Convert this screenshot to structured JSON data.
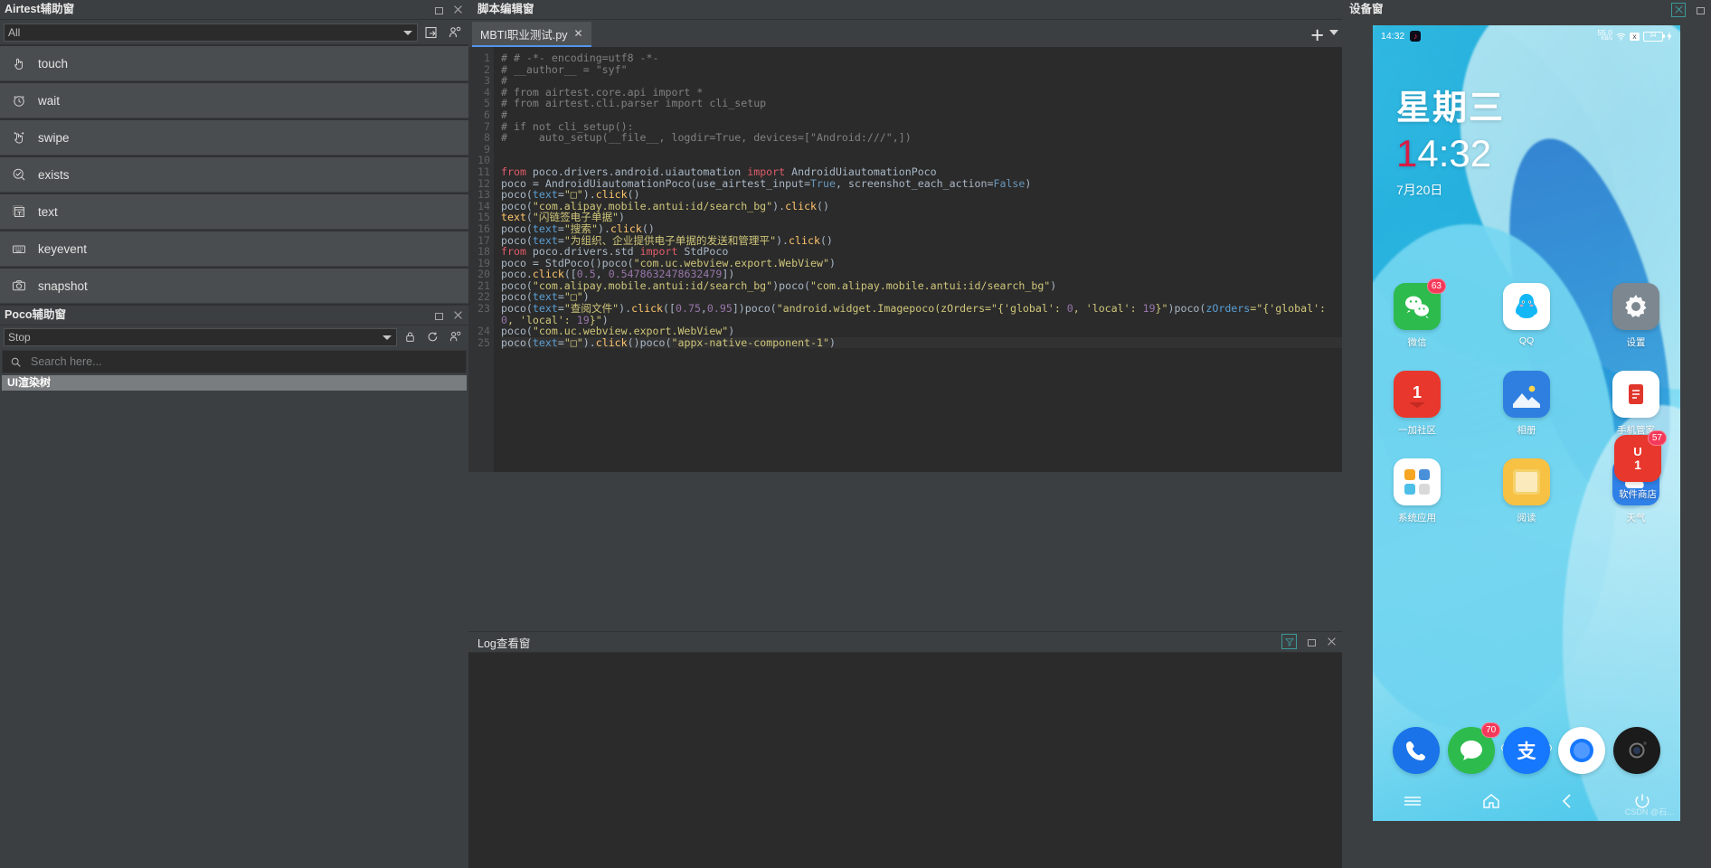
{
  "airtest_panel": {
    "title": "Airtest辅助窗",
    "filter_value": "All",
    "toolbar": [
      {
        "name": "open-script-button",
        "icon": "open-folder-icon"
      },
      {
        "name": "record-script-button",
        "icon": "record-icon"
      }
    ],
    "actions": [
      {
        "label": "touch",
        "icon": "touch-hand-icon"
      },
      {
        "label": "wait",
        "icon": "clock-icon"
      },
      {
        "label": "swipe",
        "icon": "swipe-hand-icon"
      },
      {
        "label": "exists",
        "icon": "check-circle-icon"
      },
      {
        "label": "text",
        "icon": "text-box-icon"
      },
      {
        "label": "keyevent",
        "icon": "keyboard-icon"
      },
      {
        "label": "snapshot",
        "icon": "camera-icon"
      }
    ]
  },
  "poco_panel": {
    "title": "Poco辅助窗",
    "mode_value": "Stop",
    "toolbar": [
      {
        "name": "lock-button",
        "icon": "lock-icon"
      },
      {
        "name": "refresh-button",
        "icon": "refresh-icon"
      },
      {
        "name": "inspect-button",
        "icon": "inspect-icon"
      }
    ],
    "search_placeholder": "Search here...",
    "search_value": "",
    "tree_header": "UI渲染树"
  },
  "editor": {
    "title": "脚本编辑窗",
    "tabs": [
      {
        "label": "MBTI职业测试.py",
        "close": "✕",
        "active": true
      }
    ],
    "add_tab_label": "+",
    "highlight_line": 25,
    "lines": [
      {
        "n": 1,
        "tokens": [
          {
            "t": "# # -*- encoding=utf8 -*-",
            "c": "cm"
          }
        ]
      },
      {
        "n": 2,
        "tokens": [
          {
            "t": "# __author__ = \"syf\"",
            "c": "cm"
          }
        ]
      },
      {
        "n": 3,
        "tokens": [
          {
            "t": "#",
            "c": "cm"
          }
        ]
      },
      {
        "n": 4,
        "tokens": [
          {
            "t": "# from airtest.core.api import *",
            "c": "cm"
          }
        ]
      },
      {
        "n": 5,
        "tokens": [
          {
            "t": "# from airtest.cli.parser import cli_setup",
            "c": "cm"
          }
        ]
      },
      {
        "n": 6,
        "tokens": [
          {
            "t": "#",
            "c": "cm"
          }
        ]
      },
      {
        "n": 7,
        "tokens": [
          {
            "t": "# if not cli_setup():",
            "c": "cm"
          }
        ]
      },
      {
        "n": 8,
        "tokens": [
          {
            "t": "#     auto_setup(__file__, logdir=True, devices=[\"Android:///\",])",
            "c": "cm"
          }
        ]
      },
      {
        "n": 9,
        "tokens": []
      },
      {
        "n": 10,
        "tokens": []
      },
      {
        "n": 11,
        "tokens": [
          {
            "t": "from",
            "c": "kw2"
          },
          {
            "t": " poco.drivers.android.uiautomation ",
            "c": "pl"
          },
          {
            "t": "import",
            "c": "kw2"
          },
          {
            "t": " AndroidUiautomationPoco",
            "c": "pl"
          }
        ]
      },
      {
        "n": 12,
        "tokens": [
          {
            "t": "poco = AndroidUiautomationPoco(",
            "c": "pl"
          },
          {
            "t": "use_airtest_input",
            "c": "pl"
          },
          {
            "t": "=",
            "c": "pl"
          },
          {
            "t": "True",
            "c": "vs"
          },
          {
            "t": ", ",
            "c": "pl"
          },
          {
            "t": "screenshot_each_action",
            "c": "pl"
          },
          {
            "t": "=",
            "c": "pl"
          },
          {
            "t": "False",
            "c": "vs"
          },
          {
            "t": ")",
            "c": "pl"
          }
        ]
      },
      {
        "n": 13,
        "tokens": [
          {
            "t": "poco(",
            "c": "pl"
          },
          {
            "t": "text",
            "c": "arg"
          },
          {
            "t": "=",
            "c": "pl"
          },
          {
            "t": "\"",
            "c": "str"
          },
          {
            "t": "□",
            "c": "str"
          },
          {
            "t": "\"",
            "c": "str"
          },
          {
            "t": ").",
            "c": "pl"
          },
          {
            "t": "click",
            "c": "fn"
          },
          {
            "t": "()",
            "c": "pl"
          }
        ]
      },
      {
        "n": 14,
        "tokens": [
          {
            "t": "poco(",
            "c": "pl"
          },
          {
            "t": "\"com.alipay.mobile.antui:id/search_bg\"",
            "c": "str"
          },
          {
            "t": ").",
            "c": "pl"
          },
          {
            "t": "click",
            "c": "fn"
          },
          {
            "t": "()",
            "c": "pl"
          }
        ]
      },
      {
        "n": 15,
        "tokens": [
          {
            "t": "text",
            "c": "fn"
          },
          {
            "t": "(",
            "c": "pl"
          },
          {
            "t": "\"闪链签电子单据\"",
            "c": "str"
          },
          {
            "t": ")",
            "c": "pl"
          }
        ]
      },
      {
        "n": 16,
        "tokens": [
          {
            "t": "poco(",
            "c": "pl"
          },
          {
            "t": "text",
            "c": "arg"
          },
          {
            "t": "=",
            "c": "pl"
          },
          {
            "t": "\"搜索\"",
            "c": "str"
          },
          {
            "t": ").",
            "c": "pl"
          },
          {
            "t": "click",
            "c": "fn"
          },
          {
            "t": "()",
            "c": "pl"
          }
        ]
      },
      {
        "n": 17,
        "tokens": [
          {
            "t": "poco(",
            "c": "pl"
          },
          {
            "t": "text",
            "c": "arg"
          },
          {
            "t": "=",
            "c": "pl"
          },
          {
            "t": "\"为组织、企业提供电子单据的发送和管理平\"",
            "c": "str"
          },
          {
            "t": ").",
            "c": "pl"
          },
          {
            "t": "click",
            "c": "fn"
          },
          {
            "t": "()",
            "c": "pl"
          }
        ]
      },
      {
        "n": 18,
        "tokens": [
          {
            "t": "from",
            "c": "kw2"
          },
          {
            "t": " poco.drivers.std ",
            "c": "pl"
          },
          {
            "t": "import",
            "c": "kw2"
          },
          {
            "t": " StdPoco",
            "c": "pl"
          }
        ]
      },
      {
        "n": 19,
        "tokens": [
          {
            "t": "poco = StdPoco()poco(",
            "c": "pl"
          },
          {
            "t": "\"com.uc.webview.export.WebView\"",
            "c": "str"
          },
          {
            "t": ")",
            "c": "pl"
          }
        ]
      },
      {
        "n": 20,
        "tokens": [
          {
            "t": "poco.",
            "c": "pl"
          },
          {
            "t": "click",
            "c": "fn"
          },
          {
            "t": "([",
            "c": "pl"
          },
          {
            "t": "0.5",
            "c": "num"
          },
          {
            "t": ", ",
            "c": "pl"
          },
          {
            "t": "0.5478632478632479",
            "c": "num"
          },
          {
            "t": "])",
            "c": "pl"
          }
        ]
      },
      {
        "n": 21,
        "tokens": [
          {
            "t": "poco(",
            "c": "pl"
          },
          {
            "t": "\"com.alipay.mobile.antui:id/search_bg\"",
            "c": "str"
          },
          {
            "t": ")poco(",
            "c": "pl"
          },
          {
            "t": "\"com.alipay.mobile.antui:id/search_bg\"",
            "c": "str"
          },
          {
            "t": ")",
            "c": "pl"
          }
        ]
      },
      {
        "n": 22,
        "tokens": [
          {
            "t": "poco(",
            "c": "pl"
          },
          {
            "t": "text",
            "c": "arg"
          },
          {
            "t": "=",
            "c": "pl"
          },
          {
            "t": "\"□\"",
            "c": "str"
          },
          {
            "t": ")",
            "c": "pl"
          }
        ]
      },
      {
        "n": 23,
        "wrap": true,
        "tokens": [
          {
            "t": "poco(",
            "c": "pl"
          },
          {
            "t": "text",
            "c": "arg"
          },
          {
            "t": "=",
            "c": "pl"
          },
          {
            "t": "\"查阅文件\"",
            "c": "str"
          },
          {
            "t": ").",
            "c": "pl"
          },
          {
            "t": "click",
            "c": "fn"
          },
          {
            "t": "([",
            "c": "pl"
          },
          {
            "t": "0.75",
            "c": "num"
          },
          {
            "t": ",",
            "c": "pl"
          },
          {
            "t": "0.95",
            "c": "num"
          },
          {
            "t": "])poco(",
            "c": "pl"
          },
          {
            "t": "\"android.widget.Imagepoco(zOrders=\"",
            "c": "str"
          },
          {
            "t": "{'global': ",
            "c": "str"
          },
          {
            "t": "0",
            "c": "num"
          },
          {
            "t": ", 'local': ",
            "c": "str"
          },
          {
            "t": "19",
            "c": "num"
          },
          {
            "t": "}\"",
            "c": "str"
          },
          {
            "t": ")poco(",
            "c": "pl"
          },
          {
            "t": "zOrders",
            "c": "arg"
          },
          {
            "t": "=\"",
            "c": "str"
          },
          {
            "t": "{'global': ",
            "c": "str"
          },
          {
            "t": "0",
            "c": "num"
          },
          {
            "t": ", 'local': ",
            "c": "str"
          },
          {
            "t": "19",
            "c": "num"
          },
          {
            "t": "}\"",
            "c": "str"
          },
          {
            "t": ")",
            "c": "pl"
          }
        ]
      },
      {
        "n": 24,
        "tokens": [
          {
            "t": "poco(",
            "c": "pl"
          },
          {
            "t": "\"com.uc.webview.export.WebView\"",
            "c": "str"
          },
          {
            "t": ")",
            "c": "pl"
          }
        ]
      },
      {
        "n": 25,
        "tokens": [
          {
            "t": "poco(",
            "c": "pl"
          },
          {
            "t": "text",
            "c": "arg"
          },
          {
            "t": "=",
            "c": "pl"
          },
          {
            "t": "\"□\"",
            "c": "str"
          },
          {
            "t": ").",
            "c": "pl"
          },
          {
            "t": "click",
            "c": "fn"
          },
          {
            "t": "()poco(",
            "c": "pl"
          },
          {
            "t": "\"appx-native-component-1\"",
            "c": "str"
          },
          {
            "t": ")",
            "c": "pl"
          }
        ]
      }
    ]
  },
  "log_panel": {
    "title": "Log查看窗",
    "buttons": [
      {
        "name": "filter-button",
        "icon": "filter-icon"
      },
      {
        "name": "restore-button",
        "icon": "restore-icon"
      },
      {
        "name": "close-button",
        "icon": "close-icon"
      }
    ]
  },
  "device_panel": {
    "title": "设备窗",
    "buttons": [
      {
        "name": "yoga-layout-button",
        "icon": "yoga-icon"
      },
      {
        "name": "restore-button",
        "icon": "restore-icon"
      }
    ],
    "screen": {
      "statusbar": {
        "time": "14:32",
        "app_icon": "tiktok-icon",
        "net_speed": "55.0",
        "net_unit": "KB/s",
        "wifi": "wifi-icon",
        "signal": "signal-icon",
        "battery_text": "94",
        "charging": "charging-bolt-icon"
      },
      "clock_widget": {
        "weekday": "星期三",
        "hour_first": "1",
        "time_rest": "4:32",
        "date": "7月20日"
      },
      "apps": [
        [
          {
            "label": "微信",
            "badge": "63",
            "color": "#2dbb4e",
            "glyph": "wechat-icon"
          },
          {
            "label": "QQ",
            "badge": "",
            "color": "#ffffff",
            "glyph": "qq-icon"
          },
          {
            "label": "设置",
            "badge": "",
            "color": "#7d8790",
            "glyph": "gear-icon"
          }
        ],
        [
          {
            "label": "一加社区",
            "badge": "",
            "color": "#e8372c",
            "glyph": "oneplus-community-icon"
          },
          {
            "label": "相册",
            "badge": "",
            "color": "#2f7fe0",
            "glyph": "gallery-icon"
          },
          {
            "label": "手机管家",
            "badge": "",
            "color": "#ffffff",
            "glyph": "phone-manager-icon"
          }
        ],
        [
          {
            "label": "系统应用",
            "badge": "",
            "color": "#ffffff",
            "glyph": "system-apps-folder-icon"
          },
          {
            "label": "阅读",
            "badge": "",
            "color": "#f7c144",
            "glyph": "reader-icon"
          },
          {
            "label": "天气",
            "badge": "",
            "color": "#2f80e8",
            "glyph": "weather-icon"
          }
        ]
      ],
      "dock": [
        {
          "label": "",
          "badge": "",
          "color": "#1a73e8",
          "glyph": "phone-icon"
        },
        {
          "label": "",
          "badge": "70",
          "color": "#2dbb4e",
          "glyph": "messages-icon"
        },
        {
          "label": "",
          "badge": "",
          "color": "#1677ff",
          "glyph": "alipay-icon"
        },
        {
          "label": "",
          "badge": "",
          "color": "#ffffff",
          "glyph": "browser-icon"
        },
        {
          "label": "",
          "badge": "",
          "color": "#1b1b1b",
          "glyph": "camera-app-icon"
        }
      ],
      "software_store": {
        "label": "软件商店",
        "badge": "57",
        "color": "#e8372c",
        "glyph": "store-icon"
      },
      "page_dots": [
        false,
        true,
        false,
        false
      ],
      "navbar": [
        {
          "name": "nav-menu-button",
          "icon": "menu-icon"
        },
        {
          "name": "nav-home-button",
          "icon": "home-icon"
        },
        {
          "name": "nav-back-button",
          "icon": "back-icon"
        },
        {
          "name": "nav-power-button",
          "icon": "power-icon"
        }
      ],
      "watermark": "CSDN @石…"
    }
  },
  "colors": {
    "panel_bg": "#3c3f41",
    "editor_bg": "#2b2b2b",
    "accent": "#5394ec",
    "teal": "#3c9a9a"
  }
}
